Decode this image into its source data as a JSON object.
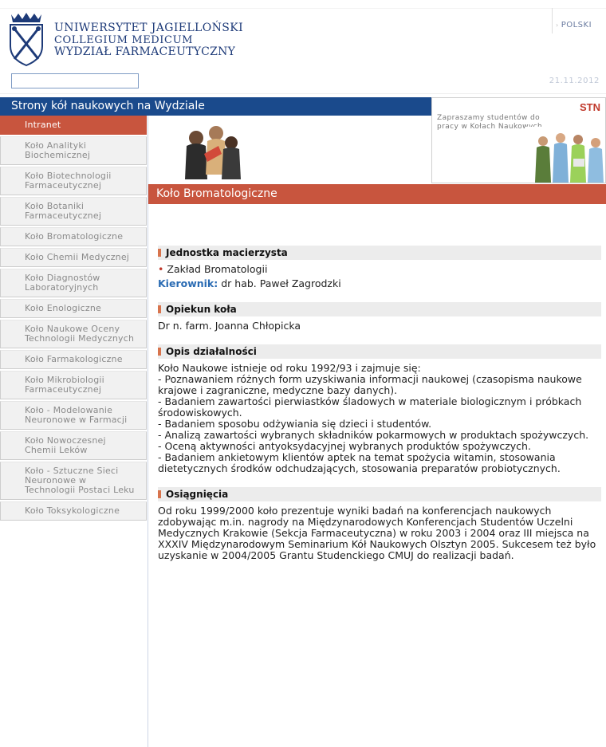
{
  "header": {
    "university_line1": "UNIWERSYTET JAGIELLOŃSKI",
    "university_line2": "COLLEGIUM MEDICUM",
    "university_line3": "WYDZIAŁ FARMACEUTYCZNY",
    "language": "POLSKI",
    "date": "21.11.2012",
    "search_value": ""
  },
  "title_bar": "Strony kół naukowych na Wydziale",
  "stn": {
    "label": "STN",
    "text": "Zapraszamy studentów do pracy w Kołach Naukowych"
  },
  "sidebar": {
    "items": [
      {
        "label": "Intranet"
      },
      {
        "label": "Koło Analityki Biochemicznej"
      },
      {
        "label": "Koło Biotechnologii Farmaceutycznej"
      },
      {
        "label": "Koło Botaniki Farmaceutycznej"
      },
      {
        "label": "Koło Bromatologiczne"
      },
      {
        "label": "Koło Chemii Medycznej"
      },
      {
        "label": "Koło Diagnostów Laboratoryjnych"
      },
      {
        "label": "Koło Enologiczne"
      },
      {
        "label": "Koło Naukowe Oceny Technologii Medycznych"
      },
      {
        "label": "Koło Farmakologiczne"
      },
      {
        "label": "Koło Mikrobiologii Farmaceutycznej"
      },
      {
        "label": "Koło - Modelowanie Neuronowe w Farmacji"
      },
      {
        "label": "Koło Nowoczesnej Chemii Leków"
      },
      {
        "label": "Koło - Sztuczne Sieci Neuronowe w Technologii Postaci Leku"
      },
      {
        "label": "Koło Toksykologiczne"
      }
    ]
  },
  "section_title": "Koło Bromatologiczne",
  "content": {
    "jednostka": {
      "heading": "Jednostka macierzysta",
      "unit": "Zakład Bromatologii",
      "kierownik_label": "Kierownik:",
      "kierownik_name": "dr hab. Paweł Zagrodzki"
    },
    "opiekun": {
      "heading": "Opiekun koła",
      "name": "Dr n. farm. Joanna Chłopicka"
    },
    "opis": {
      "heading": "Opis działalności",
      "text": "Koło Naukowe istnieje od roku 1992/93 i zajmuje się:\n- Poznawaniem różnych form uzyskiwania informacji naukowej (czasopisma naukowe krajowe i zagraniczne, medyczne bazy danych).\n- Badaniem zawartości pierwiastków śladowych w materiale biologicznym i próbkach środowiskowych.\n- Badaniem sposobu odżywiania się dzieci i studentów.\n- Analizą zawartości wybranych składników pokarmowych w produktach spożywczych.\n- Oceną aktywności antyoksydacyjnej wybranych produktów spożywczych.\n- Badaniem ankietowym klientów aptek na temat spożycia witamin, stosowania dietetycznych środków odchudzających, stosowania preparatów probiotycznych."
    },
    "osiagniecia": {
      "heading": "Osiągnięcia",
      "text": "Od roku 1999/2000 koło prezentuje wyniki badań na konferencjach naukowych zdobywając m.in. nagrody na Międzynarodowych Konferencjach Studentów Uczelni Medycznych Krakowie (Sekcja Farmaceutyczna) w roku 2003 i 2004 oraz III miejsca na XXXIV Międzynarodowym Seminarium Kół Naukowych Olsztyn 2005. Sukcesem też było uzyskanie w 2004/2005 Grantu Studenckiego CMUJ do realizacji badań."
    }
  }
}
